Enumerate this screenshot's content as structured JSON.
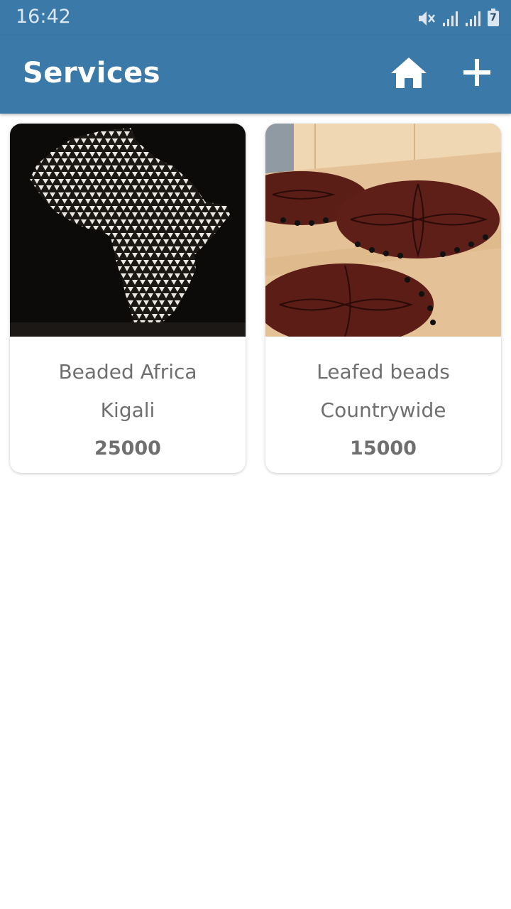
{
  "status_bar": {
    "time": "16:42",
    "icons": [
      "mute-icon",
      "signal-icon",
      "signal-icon",
      "battery-icon"
    ],
    "battery_level": "7"
  },
  "app_bar": {
    "title": "Services",
    "actions": [
      "home-icon",
      "add-icon"
    ],
    "color": "#3b79a8"
  },
  "services": [
    {
      "name": "Beaded Africa",
      "location": "Kigali",
      "price": "25000"
    },
    {
      "name": "Leafed beads",
      "location": "Countrywide",
      "price": "15000"
    }
  ]
}
